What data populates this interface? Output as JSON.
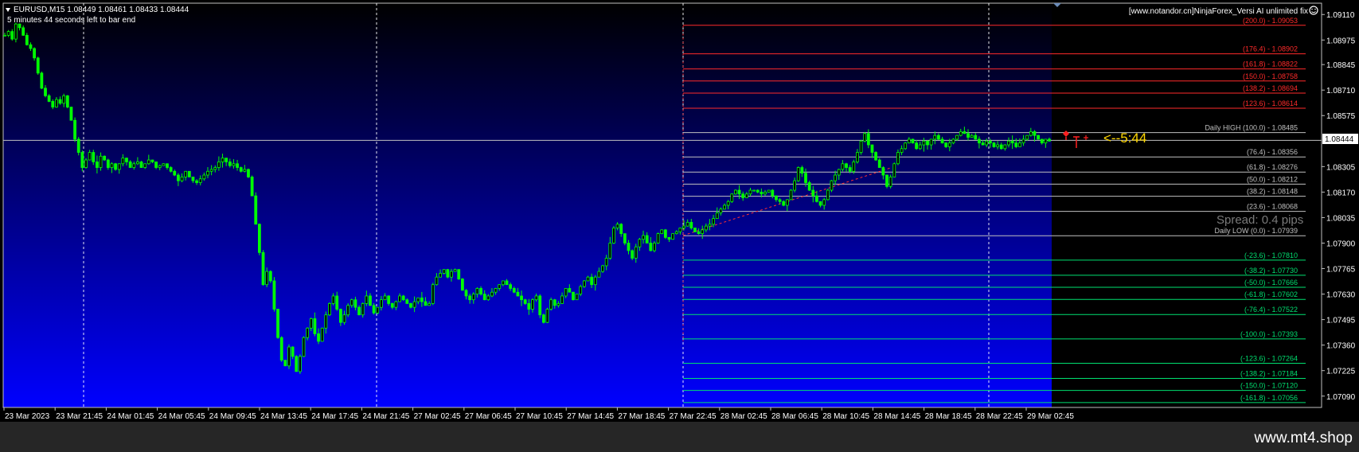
{
  "window": {
    "symbol_line": "EURUSD,M15  1.08449 1.08461 1.08433 1.08444",
    "countdown_text": "5 minutes 44 seconds left to bar end",
    "indicator_title": "[www.notandor.cn]NinjaForex_Versi AI unlimited fix",
    "timer_label": "<--5:44",
    "spread_label": "Spread: 0.4 pips",
    "watermark": "www.mt4.shop",
    "current_price": "1.08444"
  },
  "price_axis": {
    "ticks": [
      "1.09110",
      "1.08975",
      "1.08845",
      "1.08710",
      "1.08575",
      "1.08444",
      "1.08305",
      "1.08170",
      "1.08035",
      "1.07900",
      "1.07765",
      "1.07630",
      "1.07495",
      "1.07360",
      "1.07225",
      "1.07090"
    ]
  },
  "time_axis": {
    "labels": [
      "23 Mar 2023",
      "23 Mar 21:45",
      "24 Mar 01:45",
      "24 Mar 05:45",
      "24 Mar 09:45",
      "24 Mar 13:45",
      "24 Mar 17:45",
      "24 Mar 21:45",
      "27 Mar 02:45",
      "27 Mar 06:45",
      "27 Mar 10:45",
      "27 Mar 14:45",
      "27 Mar 18:45",
      "27 Mar 22:45",
      "28 Mar 02:45",
      "28 Mar 06:45",
      "28 Mar 10:45",
      "28 Mar 14:45",
      "28 Mar 18:45",
      "28 Mar 22:45",
      "29 Mar 02:45"
    ]
  },
  "fib_levels": [
    {
      "text": "(200.0) - 1.09053",
      "price": 1.09053,
      "color": "#ff2a2a"
    },
    {
      "text": "(176.4) - 1.08902",
      "price": 1.08902,
      "color": "#ff2a2a"
    },
    {
      "text": "(161.8) - 1.08822",
      "price": 1.08822,
      "color": "#ff2a2a"
    },
    {
      "text": "(150.0) - 1.08758",
      "price": 1.08758,
      "color": "#ff2a2a"
    },
    {
      "text": "(138.2) - 1.08694",
      "price": 1.08694,
      "color": "#ff2a2a"
    },
    {
      "text": "(123.6) - 1.08614",
      "price": 1.08614,
      "color": "#ff2a2a"
    },
    {
      "text": "Daily HIGH (100.0) - 1.08485",
      "price": 1.08485,
      "color": "#c0c0c0"
    },
    {
      "text": "(76.4) - 1.08356",
      "price": 1.08356,
      "color": "#c0c0c0"
    },
    {
      "text": "(61.8) - 1.08276",
      "price": 1.08276,
      "color": "#c0c0c0"
    },
    {
      "text": "(50.0) - 1.08212",
      "price": 1.08212,
      "color": "#c0c0c0"
    },
    {
      "text": "(38.2) - 1.08148",
      "price": 1.08148,
      "color": "#c0c0c0"
    },
    {
      "text": "(23.6) - 1.08068",
      "price": 1.08068,
      "color": "#c0c0c0"
    },
    {
      "text": "Daily LOW (0.0) - 1.07939",
      "price": 1.07939,
      "color": "#c0c0c0"
    },
    {
      "text": "(-23.6) - 1.07810",
      "price": 1.0781,
      "color": "#00e070"
    },
    {
      "text": "(-38.2) - 1.07730",
      "price": 1.0773,
      "color": "#00e070"
    },
    {
      "text": "(-50.0) - 1.07666",
      "price": 1.07666,
      "color": "#00e070"
    },
    {
      "text": "(-61.8) - 1.07602",
      "price": 1.07602,
      "color": "#00e070"
    },
    {
      "text": "(-76.4) - 1.07522",
      "price": 1.07522,
      "color": "#00e070"
    },
    {
      "text": "(-100.0) - 1.07393",
      "price": 1.07393,
      "color": "#00e070"
    },
    {
      "text": "(-123.6) - 1.07264",
      "price": 1.07264,
      "color": "#00e070"
    },
    {
      "text": "(-138.2) - 1.07184",
      "price": 1.07184,
      "color": "#00e070"
    },
    {
      "text": "(-150.0) - 1.07120",
      "price": 1.0712,
      "color": "#00e070"
    },
    {
      "text": "(-161.8) - 1.07056",
      "price": 1.07056,
      "color": "#00e070"
    }
  ],
  "chart_data": {
    "type": "candlestick",
    "symbol": "EURUSD",
    "timeframe": "M15",
    "ylim": [
      1.0703,
      1.0917
    ],
    "last_price": 1.08444,
    "colors": {
      "bull": "#00ff00",
      "bear": "#00ff00",
      "bg_top": "#000000",
      "bg_bottom": "#0000ff",
      "grid": "#ffffff"
    },
    "close_path": [
      1.09,
      1.0902,
      1.0898,
      1.0906,
      1.0904,
      1.09,
      1.0895,
      1.0893,
      1.0888,
      1.088,
      1.0872,
      1.0868,
      1.0865,
      1.0862,
      1.0866,
      1.0864,
      1.0868,
      1.0862,
      1.0855,
      1.0845,
      1.0838,
      1.083,
      1.0834,
      1.0838,
      1.0833,
      1.083,
      1.0836,
      1.0834,
      1.083,
      1.0832,
      1.0829,
      1.0832,
      1.0835,
      1.0833,
      1.083,
      1.0832,
      1.0833,
      1.083,
      1.0832,
      1.0834,
      1.0833,
      1.083,
      1.0831,
      1.0832,
      1.083,
      1.0828,
      1.0826,
      1.0823,
      1.0825,
      1.0828,
      1.0825,
      1.0823,
      1.0822,
      1.0824,
      1.0826,
      1.0828,
      1.0829,
      1.083,
      1.0833,
      1.0835,
      1.0833,
      1.0831,
      1.0832,
      1.083,
      1.0828,
      1.0829,
      1.0825,
      1.0815,
      1.08,
      1.0785,
      1.0768,
      1.0775,
      1.077,
      1.0755,
      1.074,
      1.0728,
      1.0725,
      1.0735,
      1.073,
      1.0722,
      1.073,
      1.074,
      1.0745,
      1.075,
      1.0742,
      1.0738,
      1.0745,
      1.0752,
      1.0758,
      1.0762,
      1.0755,
      1.0748,
      1.0752,
      1.0757,
      1.076,
      1.0756,
      1.0752,
      1.0758,
      1.0762,
      1.0757,
      1.0753,
      1.0756,
      1.076,
      1.0762,
      1.0758,
      1.0756,
      1.0759,
      1.0762,
      1.076,
      1.0758,
      1.0756,
      1.0759,
      1.0761,
      1.0759,
      1.0757,
      1.0758,
      1.0768,
      1.0772,
      1.0774,
      1.0776,
      1.0772,
      1.0775,
      1.0776,
      1.0771,
      1.0765,
      1.0762,
      1.076,
      1.0763,
      1.0766,
      1.0763,
      1.076,
      1.0762,
      1.0764,
      1.0766,
      1.0768,
      1.077,
      1.0768,
      1.0766,
      1.0764,
      1.0762,
      1.076,
      1.0758,
      1.0755,
      1.076,
      1.0762,
      1.0752,
      1.0748,
      1.0755,
      1.076,
      1.0757,
      1.0758,
      1.0762,
      1.0766,
      1.0764,
      1.076,
      1.0763,
      1.0767,
      1.077,
      1.0772,
      1.0768,
      1.0772,
      1.0775,
      1.0778,
      1.0782,
      1.079,
      1.0798,
      1.08,
      1.0795,
      1.079,
      1.0786,
      1.0782,
      1.0788,
      1.0792,
      1.0794,
      1.079,
      1.0786,
      1.079,
      1.0795,
      1.0797,
      1.0793,
      1.0792,
      1.0795,
      1.0796,
      1.0798,
      1.0799,
      1.0801,
      1.0798,
      1.0796,
      1.0795,
      1.0797,
      1.0799,
      1.08,
      1.0803,
      1.0806,
      1.0808,
      1.081,
      1.0812,
      1.0816,
      1.0818,
      1.0816,
      1.0814,
      1.0816,
      1.0818,
      1.0818,
      1.0817,
      1.0816,
      1.0817,
      1.0818,
      1.0815,
      1.0813,
      1.0812,
      1.081,
      1.0813,
      1.0818,
      1.0823,
      1.083,
      1.0827,
      1.0822,
      1.0818,
      1.0815,
      1.0812,
      1.081,
      1.0813,
      1.0818,
      1.0823,
      1.0826,
      1.0829,
      1.0832,
      1.083,
      1.0828,
      1.0833,
      1.0838,
      1.0844,
      1.0848,
      1.0842,
      1.0838,
      1.0834,
      1.083,
      1.0826,
      1.082,
      1.0825,
      1.0832,
      1.0838,
      1.084,
      1.0843,
      1.0845,
      1.0843,
      1.084,
      1.0842,
      1.0844,
      1.0842,
      1.0845,
      1.0847,
      1.0845,
      1.0843,
      1.0841,
      1.0843,
      1.0845,
      1.0847,
      1.0849,
      1.0848,
      1.0846,
      1.0847,
      1.0845,
      1.0843,
      1.0842,
      1.0844,
      1.0843,
      1.0841,
      1.0842,
      1.084,
      1.0842,
      1.0844,
      1.0843,
      1.0841,
      1.0843,
      1.0845,
      1.0847,
      1.0849,
      1.0847,
      1.0845,
      1.0843,
      1.0845,
      1.0844
    ]
  }
}
